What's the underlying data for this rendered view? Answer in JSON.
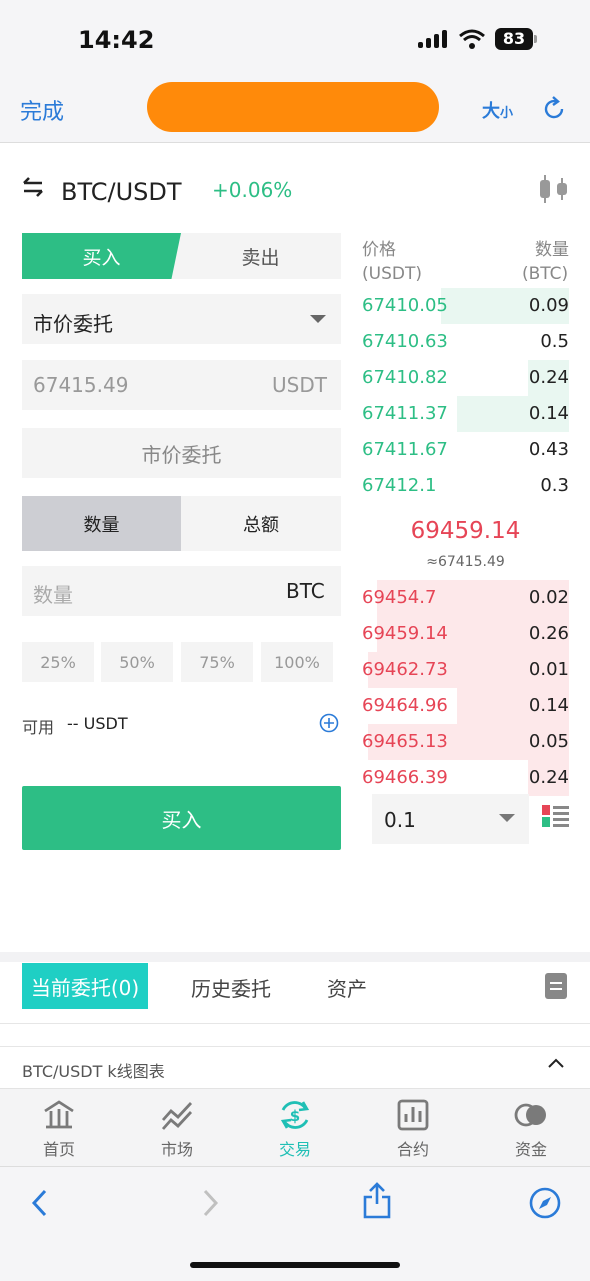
{
  "status_bar": {
    "time": "14:42",
    "battery": "83"
  },
  "header": {
    "done_label": "完成",
    "font_size_label_big": "大",
    "font_size_label_small": "小"
  },
  "pair": {
    "name": "BTC/USDT",
    "change": "+0.06%"
  },
  "trade_tabs": {
    "buy": "买入",
    "sell": "卖出"
  },
  "order_form": {
    "order_type": "市价委托",
    "price_value": "67415.49",
    "price_unit": "USDT",
    "market_button": "市价委托",
    "qty_tab": "数量",
    "total_tab": "总额",
    "qty_placeholder": "数量",
    "qty_unit": "BTC",
    "percentages": [
      "25%",
      "50%",
      "75%",
      "100%"
    ],
    "available_label": "可用",
    "available_value": "-- USDT",
    "submit_label": "买入"
  },
  "order_book": {
    "header_price": "价格",
    "header_price_unit": "(USDT)",
    "header_qty": "数量",
    "header_qty_unit": "(BTC)",
    "bids": [
      {
        "price": "67410.05",
        "qty": "0.09",
        "depth": 0.62
      },
      {
        "price": "67410.63",
        "qty": "0.5",
        "depth": 0
      },
      {
        "price": "67410.82",
        "qty": "0.24",
        "depth": 0.2
      },
      {
        "price": "67411.37",
        "qty": "0.14",
        "depth": 0.54
      },
      {
        "price": "67411.67",
        "qty": "0.43",
        "depth": 0
      },
      {
        "price": "67412.1",
        "qty": "0.3",
        "depth": 0
      }
    ],
    "last_price": "69459.14",
    "last_fiat": "≈67415.49",
    "asks": [
      {
        "price": "69454.7",
        "qty": "0.02",
        "depth": 0.93
      },
      {
        "price": "69459.14",
        "qty": "0.26",
        "depth": 0.93
      },
      {
        "price": "69462.73",
        "qty": "0.01",
        "depth": 0.97
      },
      {
        "price": "69464.96",
        "qty": "0.14",
        "depth": 0.54
      },
      {
        "price": "69465.13",
        "qty": "0.05",
        "depth": 0.97
      },
      {
        "price": "69466.39",
        "qty": "0.24",
        "depth": 0.2
      }
    ],
    "depth_step": "0.1"
  },
  "orders_tabs": {
    "current": "当前委托(0)",
    "history": "历史委托",
    "assets": "资产"
  },
  "kline": {
    "label": "BTC/USDT k线图表"
  },
  "bottom_nav": [
    {
      "label": "首页",
      "icon": "home-icon"
    },
    {
      "label": "市场",
      "icon": "market-icon"
    },
    {
      "label": "交易",
      "icon": "trade-icon",
      "active": true
    },
    {
      "label": "合约",
      "icon": "contract-icon"
    },
    {
      "label": "资金",
      "icon": "funds-icon"
    }
  ],
  "colors": {
    "green": "#2dbe85",
    "red": "#e64556",
    "accent": "#1fcfc4",
    "link": "#2b7bd8",
    "title_redaction": "#ff8a0a"
  }
}
